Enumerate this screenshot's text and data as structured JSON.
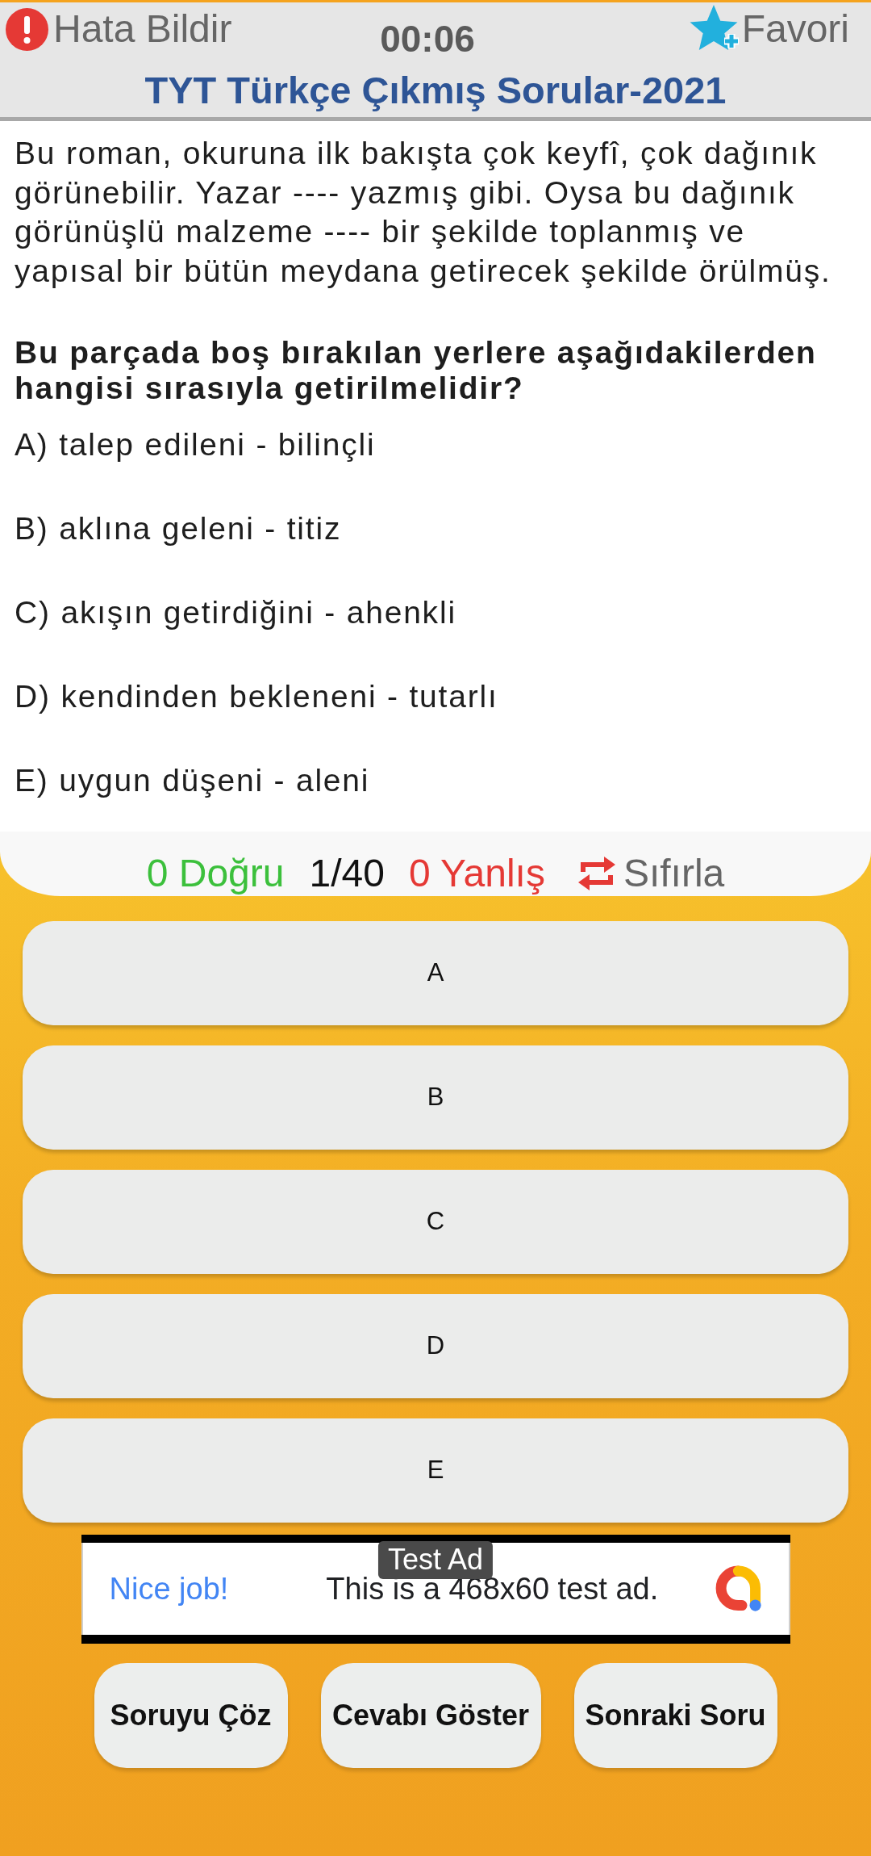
{
  "header": {
    "report_button": "Hata Bildir",
    "timer": "00:06",
    "favorite_button": "Favori",
    "title": "TYT Türkçe Çıkmış Sorular-2021"
  },
  "question": {
    "passage": "Bu roman, okuruna ilk bakışta çok keyfî, çok dağınık\ngörünebilir. Yazar ---- yazmış gibi. Oysa bu dağınık\ngörünüşlü malzeme ---- bir şekilde toplanmış ve\nyapısal bir bütün meydana getirecek şekilde örülmüş.",
    "prompt": "Bu parçada boş bırakılan yerlere aşağıdakilerden\nhangisi sırasıyla getirilmelidir?",
    "options": [
      "A) talep edileni - bilinçli",
      "B) aklına geleni - titiz",
      "C) akışın getirdiğini - ahenkli",
      "D) kendinden bekleneni - tutarlı",
      "E) uygun düşeni - aleni"
    ]
  },
  "score": {
    "correct": "0 Doğru",
    "counter": "1/40",
    "wrong": "0 Yanlış",
    "reset_button": "Sıfırla"
  },
  "answer_buttons": [
    "A",
    "B",
    "C",
    "D",
    "E"
  ],
  "ad": {
    "badge": "Test Ad",
    "headline": "Nice job!",
    "body": "This is a 468x60 test ad."
  },
  "action_buttons": [
    "Soruyu Çöz",
    "Cevabı Göster",
    "Sonraki Soru"
  ]
}
